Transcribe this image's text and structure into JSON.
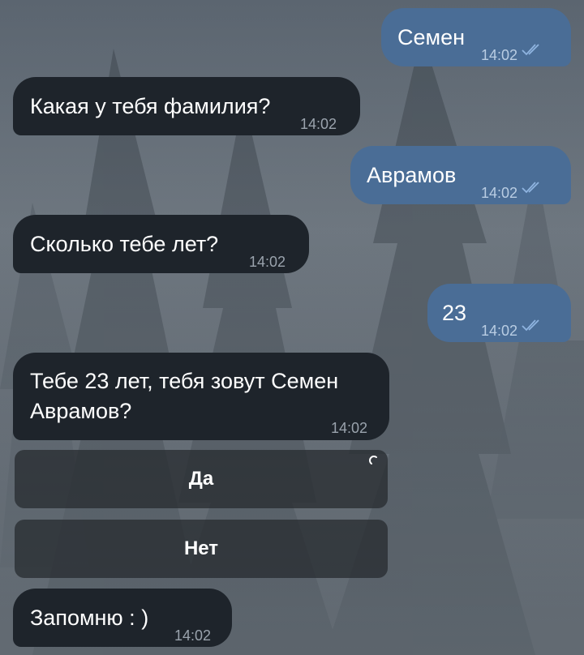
{
  "messages": [
    {
      "dir": "out",
      "text": "Семен",
      "time": "14:02"
    },
    {
      "dir": "in",
      "text": "Какая у тебя фамилия?",
      "time": "14:02"
    },
    {
      "dir": "out",
      "text": "Аврамов",
      "time": "14:02"
    },
    {
      "dir": "in",
      "text": "Сколько тебе лет?",
      "time": "14:02"
    },
    {
      "dir": "out",
      "text": "23",
      "time": "14:02"
    },
    {
      "dir": "in",
      "text_line1": "Тебе 23 лет, тебя зовут Семен",
      "text_line2": "Аврамов?",
      "time": "14:02"
    },
    {
      "dir": "in",
      "text": "Запомню : )",
      "time": "14:02"
    }
  ],
  "keyboard": {
    "yes_label": "Да",
    "no_label": "Нет"
  },
  "colors": {
    "incoming_bubble": "#1e242b",
    "outgoing_bubble": "#4a6d96",
    "read_ticks": "#8fb4e0"
  },
  "icons": {
    "read_receipt": "double-check-icon",
    "loading": "spinner-icon"
  }
}
